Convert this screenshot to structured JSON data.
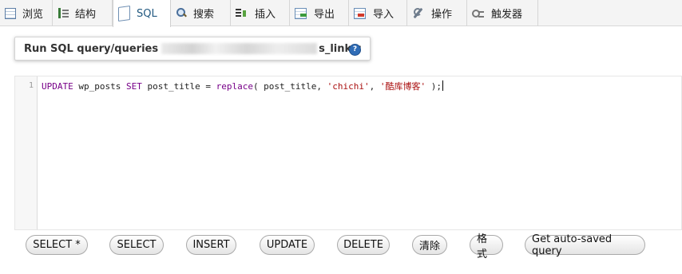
{
  "tabs": [
    {
      "label": "浏览",
      "icon": "browse-table-icon"
    },
    {
      "label": "结构",
      "icon": "structure-icon"
    },
    {
      "label": "SQL",
      "icon": "sql-page-icon",
      "active": true
    },
    {
      "label": "搜索",
      "icon": "search-icon"
    },
    {
      "label": "插入",
      "icon": "insert-icon"
    },
    {
      "label": "导出",
      "icon": "export-icon"
    },
    {
      "label": "导入",
      "icon": "import-icon"
    },
    {
      "label": "操作",
      "icon": "operations-wrench-icon"
    },
    {
      "label": "触发器",
      "icon": "triggers-icon"
    }
  ],
  "query_header": {
    "prefix": "Run SQL query/queries",
    "suffix": "s_links:",
    "help_glyph": "?"
  },
  "editor": {
    "line_number": "1",
    "tokens": {
      "kw_update": "UPDATE",
      "table": " wp_posts ",
      "kw_set": "SET",
      "mid": " post_title = ",
      "fn_replace": "replace",
      "args_open": "( post_title, ",
      "str_from": "'chichi'",
      "comma": ", ",
      "str_to": "'酷库博客'",
      "close": " );"
    }
  },
  "buttons": [
    {
      "label": "SELECT *"
    },
    {
      "label": "SELECT"
    },
    {
      "label": "INSERT"
    },
    {
      "label": "UPDATE"
    },
    {
      "label": "DELETE"
    },
    {
      "label": "清除"
    },
    {
      "label": "格式"
    },
    {
      "label": "Get auto-saved query"
    }
  ],
  "colors": {
    "active_tab_text": "#235a81",
    "sql_keyword": "#770088",
    "sql_string": "#aa1111",
    "help_icon": "#2f6cb6"
  }
}
